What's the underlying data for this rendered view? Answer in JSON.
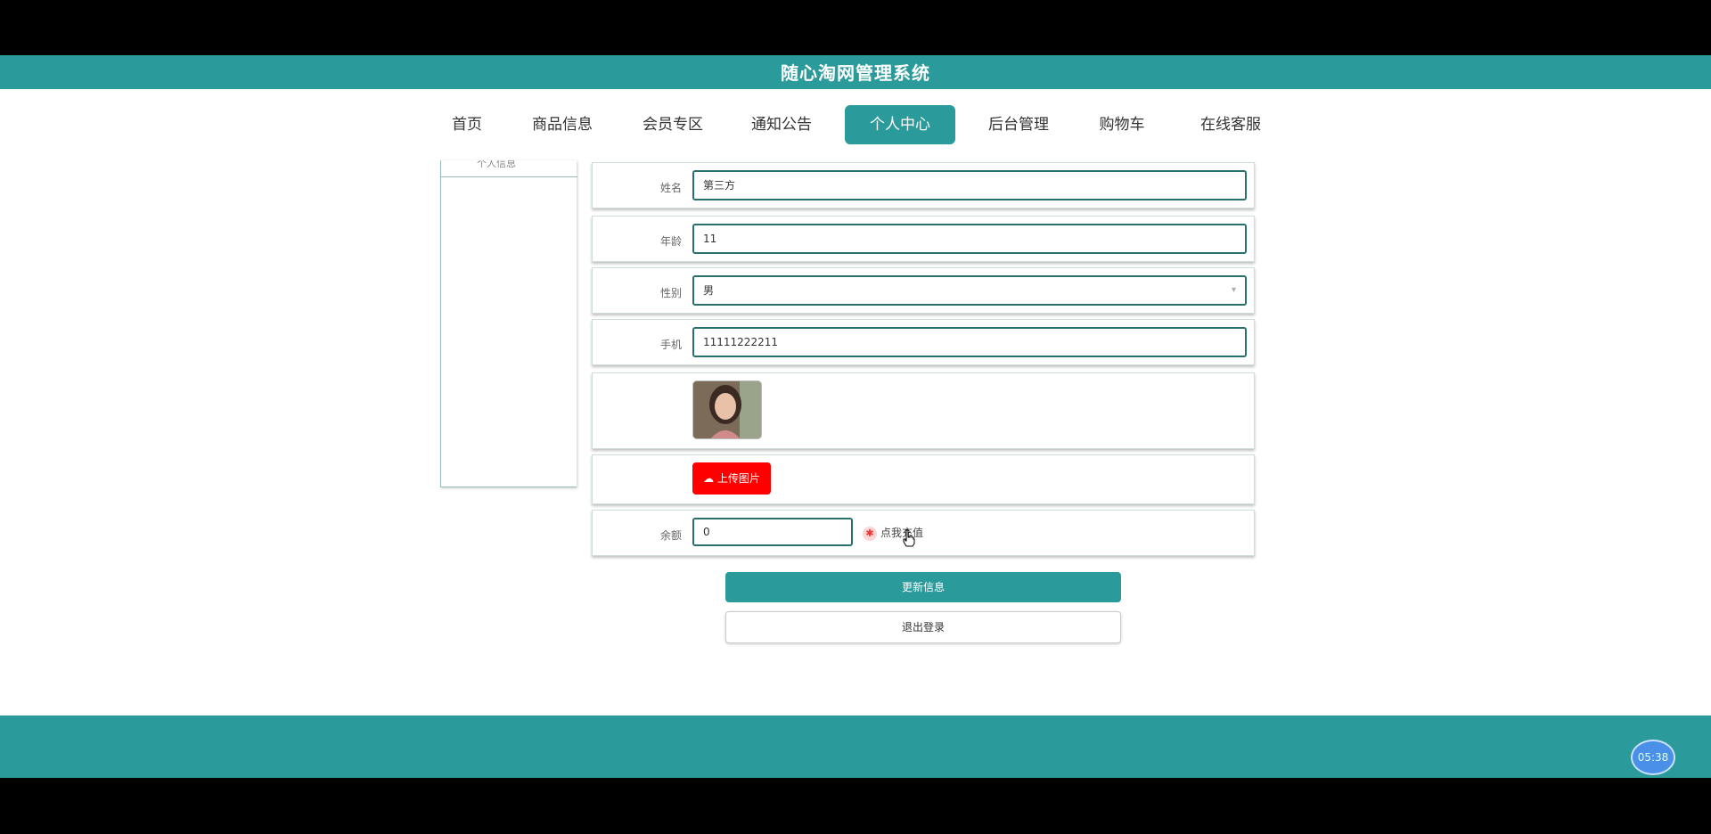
{
  "header": {
    "title": "随心淘网管理系统"
  },
  "nav": {
    "items": [
      {
        "label": "首页"
      },
      {
        "label": "商品信息"
      },
      {
        "label": "会员专区"
      },
      {
        "label": "通知公告"
      },
      {
        "label": "个人中心"
      },
      {
        "label": "后台管理"
      },
      {
        "label": "购物车"
      },
      {
        "label": "在线客服"
      }
    ],
    "active": "个人中心"
  },
  "sidebar": {
    "partial_text": "个人信息"
  },
  "form": {
    "name": {
      "label": "姓名",
      "value": "第三方"
    },
    "age": {
      "label": "年龄",
      "value": "11"
    },
    "gender": {
      "label": "性别",
      "value": "男"
    },
    "phone": {
      "label": "手机",
      "value": "11111222211"
    },
    "upload_label": "上传图片",
    "balance": {
      "label": "余额",
      "value": "0",
      "recharge_label": "点我充值"
    }
  },
  "buttons": {
    "update": "更新信息",
    "logout": "退出登录"
  },
  "timer": {
    "text": "05:38"
  },
  "colors": {
    "primary": "#2a9b9a",
    "upload": "#ff0000"
  }
}
